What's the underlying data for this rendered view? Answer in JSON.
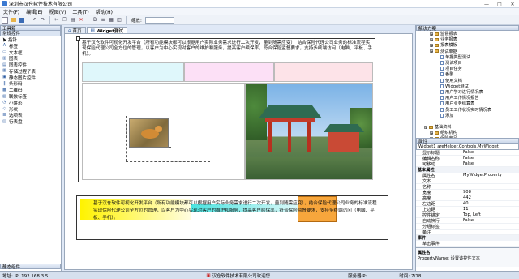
{
  "app_title": "深圳市汉仓软件技术有限公司",
  "window_controls": [
    "—",
    "□",
    "✕"
  ],
  "menu": [
    "文件(F)",
    "编辑(E)",
    "视图(V)",
    "工具(T)",
    "帮助(H)"
  ],
  "toolbar": {
    "zoom_label": "缩放:"
  },
  "toolbox": {
    "title": "工具箱",
    "section_title": "常规控件",
    "items": [
      "指针",
      "标签",
      "文本框",
      "图表",
      "图表控件",
      "存储过程子表",
      "静态图片控件",
      "条形码",
      "二维码",
      "联数标签",
      "小饼形",
      "形状",
      "选项表",
      "行表盘"
    ],
    "footer": "静态组件"
  },
  "tabs": [
    {
      "label": "首页"
    },
    {
      "label": "Widget测试"
    }
  ],
  "canvas": {
    "paragraph": "基于汉仓软件可视化开发平台（所有功能模块都可以根据用户实际业务需求进行二次开发，量到随需应变），结合保险代理公司业务的标准流程实现保险代理公司全方位的管理，以客户为中心实现对客户的维护和服务，提高客户续保率，符合保险监督要求，支持多终端访问（电脑、平板、手机）。",
    "bottom_paragraph": "基于汉仓软件可视化开发平台（所有功能模块都可以根据用户实际业务需求进行二次开发，量到随需应变），结合保险代理公司业务的标准流程实现保险代理公司全方位的管理，以客户为中心实现对客户的维护和服务，提高客户续保率，符合保险监督要求，支持多终端访问（电脑、平板、手机）。",
    "cell_colors": [
      "#dff7fb",
      "#fce0f6",
      "#fde3e8"
    ]
  },
  "solution": {
    "title": "解决方案",
    "nodes": [
      {
        "text": "监督报表",
        "level": 2,
        "type": "folder"
      },
      {
        "text": "业务报表",
        "level": 2,
        "type": "folder"
      },
      {
        "text": "报表模板",
        "level": 2,
        "type": "folder"
      },
      {
        "text": "测试单据",
        "level": 2,
        "type": "folder"
      },
      {
        "text": "单据类型测试",
        "level": 3,
        "type": "doc"
      },
      {
        "text": "测试项目",
        "level": 3,
        "type": "doc"
      },
      {
        "text": "项目任务",
        "level": 3,
        "type": "doc"
      },
      {
        "text": "番剧",
        "level": 3,
        "type": "doc"
      },
      {
        "text": "使用文档",
        "level": 3,
        "type": "doc"
      },
      {
        "text": "Widget测试",
        "level": 3,
        "type": "doc"
      },
      {
        "text": "用户学习进行情况表",
        "level": 3,
        "type": "doc"
      },
      {
        "text": "用户工作情况报告",
        "level": 3,
        "type": "doc"
      },
      {
        "text": "用户业务结算表",
        "level": 3,
        "type": "doc"
      },
      {
        "text": "员工工作状况实时情况表",
        "level": 3,
        "type": "doc"
      },
      {
        "text": "添加",
        "level": 3,
        "type": "doc"
      },
      {
        "text": "",
        "level": 0,
        "type": "blank"
      },
      {
        "text": "基础资料",
        "level": 1,
        "type": "folder"
      },
      {
        "text": "组织机构",
        "level": 2,
        "type": "folder"
      },
      {
        "text": "保险产品",
        "level": 2,
        "type": "folder"
      }
    ]
  },
  "properties": {
    "title": "属性",
    "object": "Widget1  areHelper.Controls.MyWidget",
    "rows": [
      {
        "k": "显示标题",
        "v": "False",
        "cat": false
      },
      {
        "k": "编辑名称",
        "v": "False",
        "cat": false
      },
      {
        "k": "可移动",
        "v": "False",
        "cat": false
      },
      {
        "k": "基本属性",
        "v": "",
        "cat": true
      },
      {
        "k": "属性名",
        "v": "MyWidgetProperty",
        "cat": false
      },
      {
        "k": "文本",
        "v": "",
        "cat": false
      },
      {
        "k": "名称",
        "v": "",
        "cat": false
      },
      {
        "k": "宽度",
        "v": "908",
        "cat": false
      },
      {
        "k": "高度",
        "v": "442",
        "cat": false
      },
      {
        "k": "左边距",
        "v": "40",
        "cat": false
      },
      {
        "k": "上边距",
        "v": "11",
        "cat": false
      },
      {
        "k": "控件锚定",
        "v": "Top, Left",
        "cat": false
      },
      {
        "k": "自动换行",
        "v": "False",
        "cat": false
      },
      {
        "k": "分组标签",
        "v": "",
        "cat": false
      },
      {
        "k": "备注",
        "v": "",
        "cat": false
      },
      {
        "k": "事件",
        "v": "",
        "cat": true
      },
      {
        "k": "单击事件",
        "v": "",
        "cat": false
      }
    ],
    "desc_title": "属性名",
    "desc_text": "PropertyName: 设置该控件文本"
  },
  "status": {
    "ip": "地址: IP: 192.168.3.5",
    "company": "汉仓软件技术有限公司欢迎您",
    "server": "服务器IP:",
    "time": "时间: 7/18"
  }
}
